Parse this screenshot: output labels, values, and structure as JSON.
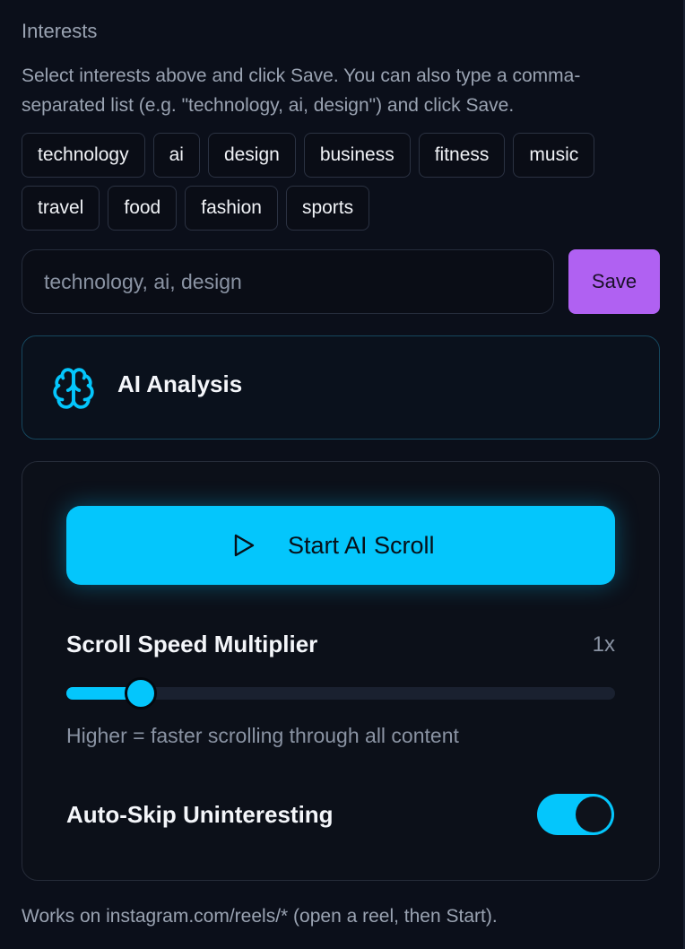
{
  "interests": {
    "title": "Interests",
    "help": "Select interests above and click Save. You can also type a comma-separated list (e.g. \"technology, ai, design\") and click Save.",
    "chips_row1": [
      "technology",
      "ai",
      "design",
      "business",
      "fitness",
      "music"
    ],
    "chips_row2": [
      "travel",
      "food",
      "fashion",
      "sports"
    ],
    "input_placeholder": "technology, ai, design",
    "input_value": "",
    "save_label": "Save"
  },
  "analysis": {
    "title": "AI Analysis",
    "icon": "brain-icon"
  },
  "controls": {
    "start_label": "Start AI Scroll",
    "start_icon": "play-icon",
    "speed_label": "Scroll Speed Multiplier",
    "speed_value": "1x",
    "speed_fraction": 0.135,
    "speed_help": "Higher = faster scrolling through all content",
    "auto_skip_label": "Auto-Skip Uninteresting",
    "auto_skip_on": true
  },
  "footer": {
    "note": "Works on instagram.com/reels/* (open a reel, then Start)."
  },
  "colors": {
    "accent": "#04c6fc",
    "save": "#b061f2",
    "background": "#0b0f1a"
  }
}
